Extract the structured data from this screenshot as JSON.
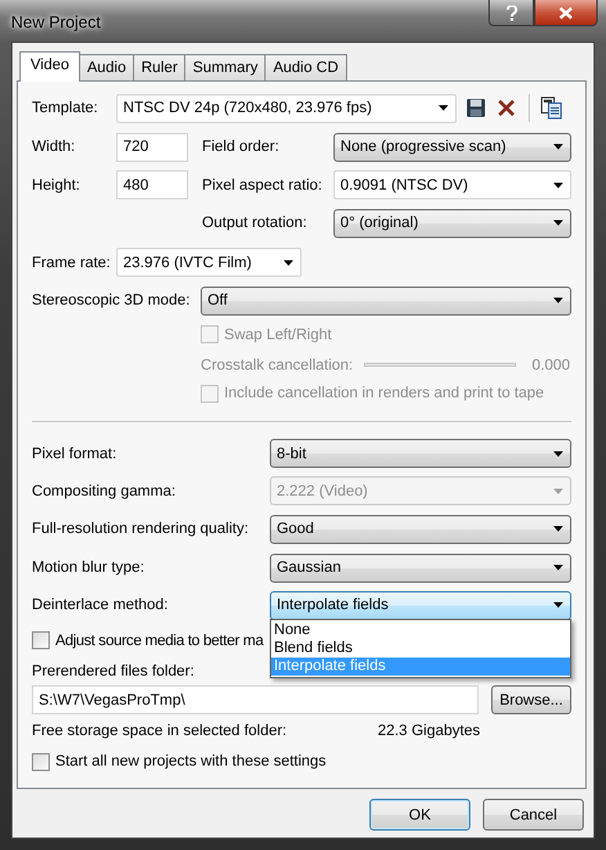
{
  "window": {
    "title": "New Project"
  },
  "tabs": [
    {
      "label": "Video",
      "selected": true
    },
    {
      "label": "Audio",
      "selected": false
    },
    {
      "label": "Ruler",
      "selected": false
    },
    {
      "label": "Summary",
      "selected": false
    },
    {
      "label": "Audio CD",
      "selected": false
    }
  ],
  "template": {
    "label": "Template:",
    "value": "NTSC DV 24p (720x480, 23.976 fps)"
  },
  "width": {
    "label": "Width:",
    "value": "720"
  },
  "height": {
    "label": "Height:",
    "value": "480"
  },
  "field_order": {
    "label": "Field order:",
    "value": "None (progressive scan)",
    "kind": "list"
  },
  "pixel_aspect_ratio": {
    "label": "Pixel aspect ratio:",
    "value": "0.9091 (NTSC DV)",
    "kind": "editable"
  },
  "output_rotation": {
    "label": "Output rotation:",
    "value": "0° (original)",
    "kind": "list"
  },
  "frame_rate": {
    "label": "Frame rate:",
    "value": "23.976 (IVTC Film)",
    "kind": "editable"
  },
  "stereoscopic_3d_mode": {
    "label": "Stereoscopic 3D mode:",
    "value": "Off",
    "kind": "list"
  },
  "swap_left_right": {
    "label": "Swap Left/Right",
    "checked": false,
    "disabled": true
  },
  "crosstalk_cancellation": {
    "label": "Crosstalk cancellation:",
    "reading": "0.000",
    "disabled": true
  },
  "include_cancellation": {
    "label": "Include cancellation in renders and print to tape",
    "checked": false,
    "disabled": true
  },
  "settings": [
    {
      "label": "Pixel format:",
      "value": "8-bit",
      "disabled": false,
      "focused": false
    },
    {
      "label": "Compositing gamma:",
      "value": "2.222 (Video)",
      "disabled": true,
      "focused": false
    },
    {
      "label": "Full-resolution rendering quality:",
      "value": "Good",
      "disabled": false,
      "focused": false
    },
    {
      "label": "Motion blur type:",
      "value": "Gaussian",
      "disabled": false,
      "focused": false
    },
    {
      "label": "Deinterlace method:",
      "value": "Interpolate fields",
      "disabled": false,
      "focused": true,
      "options": [
        {
          "label": "None",
          "selected": false
        },
        {
          "label": "Blend fields",
          "selected": false
        },
        {
          "label": "Interpolate fields",
          "selected": true
        }
      ]
    }
  ],
  "adjust_source_media": {
    "label": "Adjust source media to better ma",
    "checked": false
  },
  "prerendered_files_folder": {
    "label": "Prerendered files folder:",
    "value": "S:\\W7\\VegasProTmp\\",
    "browse": "Browse..."
  },
  "free_storage": {
    "label": "Free storage space in selected folder:",
    "value": "22.3 Gigabytes"
  },
  "start_all_new_projects": {
    "label": "Start all new projects with these settings",
    "checked": false
  },
  "buttons": [
    {
      "label": "OK",
      "default": true
    },
    {
      "label": "Cancel",
      "default": false
    }
  ]
}
